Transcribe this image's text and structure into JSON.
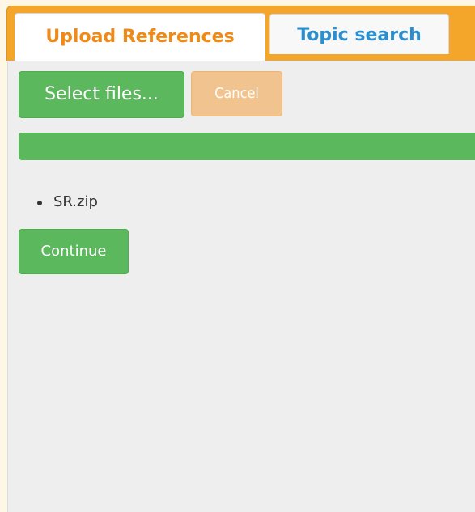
{
  "tabs": [
    {
      "label": "Upload References",
      "active": true
    },
    {
      "label": "Topic search",
      "active": false
    }
  ],
  "upload": {
    "select_label": "Select files...",
    "cancel_label": "Cancel",
    "progress_fraction": 1.0,
    "files": [
      "SR.zip"
    ],
    "continue_label": "Continue"
  },
  "colors": {
    "tab_bar": "#f3a629",
    "active_tab_text": "#ef8a17",
    "inactive_tab_text": "#2b8fcf",
    "success_green": "#5cb85c",
    "cancel_disabled": "#f1c48f",
    "panel_bg": "#eeeeee"
  }
}
